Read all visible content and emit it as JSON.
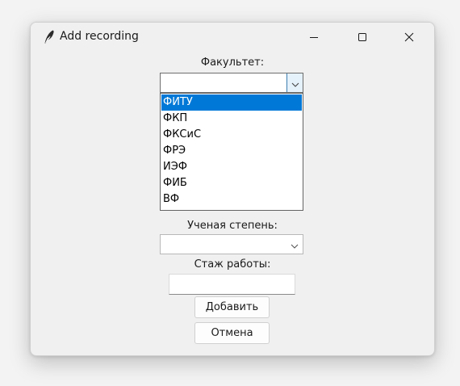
{
  "window": {
    "title": "Add recording",
    "icon": "feather-icon",
    "controls": [
      "minimize-icon",
      "maximize-icon",
      "close-icon"
    ]
  },
  "form": {
    "faculty_label": "Факультет:",
    "faculty_value": "",
    "faculty_options": [
      "ФИТУ",
      "ФКП",
      "ФКСиС",
      "ФРЭ",
      "ИЭФ",
      "ФИБ",
      "ВФ"
    ],
    "faculty_highlighted": "ФИТУ",
    "degree_label": "Ученая степень:",
    "degree_value": "",
    "experience_label": "Стаж работы:",
    "experience_value": "",
    "add_button": "Добавить",
    "cancel_button": "Отмена"
  },
  "colors": {
    "selection": "#0078d7",
    "window_bg": "#f0f0f0"
  }
}
